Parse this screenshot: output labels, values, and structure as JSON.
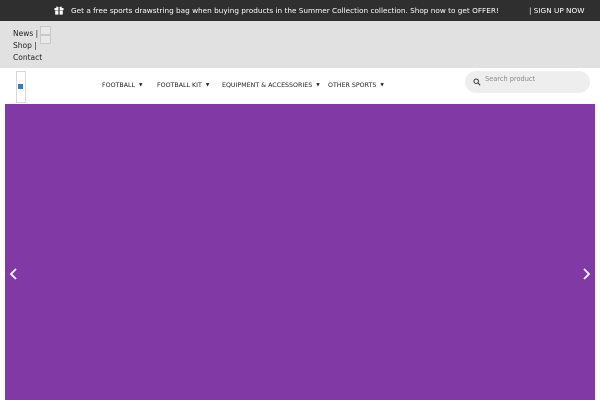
{
  "topbar": {
    "promo_text": "Get a free sports drawstring bag when buying products in the Summer Collection collection. Shop now to get OFFER!",
    "signup_label": "| SIGN UP NOW",
    "gift_icon": "gift-icon"
  },
  "subbar": {
    "links": [
      {
        "label": "News |"
      },
      {
        "label": "Shop |"
      },
      {
        "label": "Contact"
      }
    ]
  },
  "nav": {
    "items": [
      {
        "label": "FOOTBALL"
      },
      {
        "label": "FOOTBALL KIT"
      },
      {
        "label": "EQUIPMENT & ACCESSORIES"
      },
      {
        "label": "OTHER SPORTS"
      }
    ],
    "caret_icon": "caret-down-icon"
  },
  "search": {
    "placeholder": "Search product",
    "icon": "search-icon"
  },
  "hero": {
    "background_color": "#813aa5",
    "prev_icon": "chevron-left-icon",
    "next_icon": "chevron-right-icon"
  },
  "colors": {
    "topbar_bg": "#2f2f2f",
    "subbar_bg": "#e1e1e1",
    "search_bg": "#eeeeee",
    "hero_bg": "#813aa5"
  }
}
